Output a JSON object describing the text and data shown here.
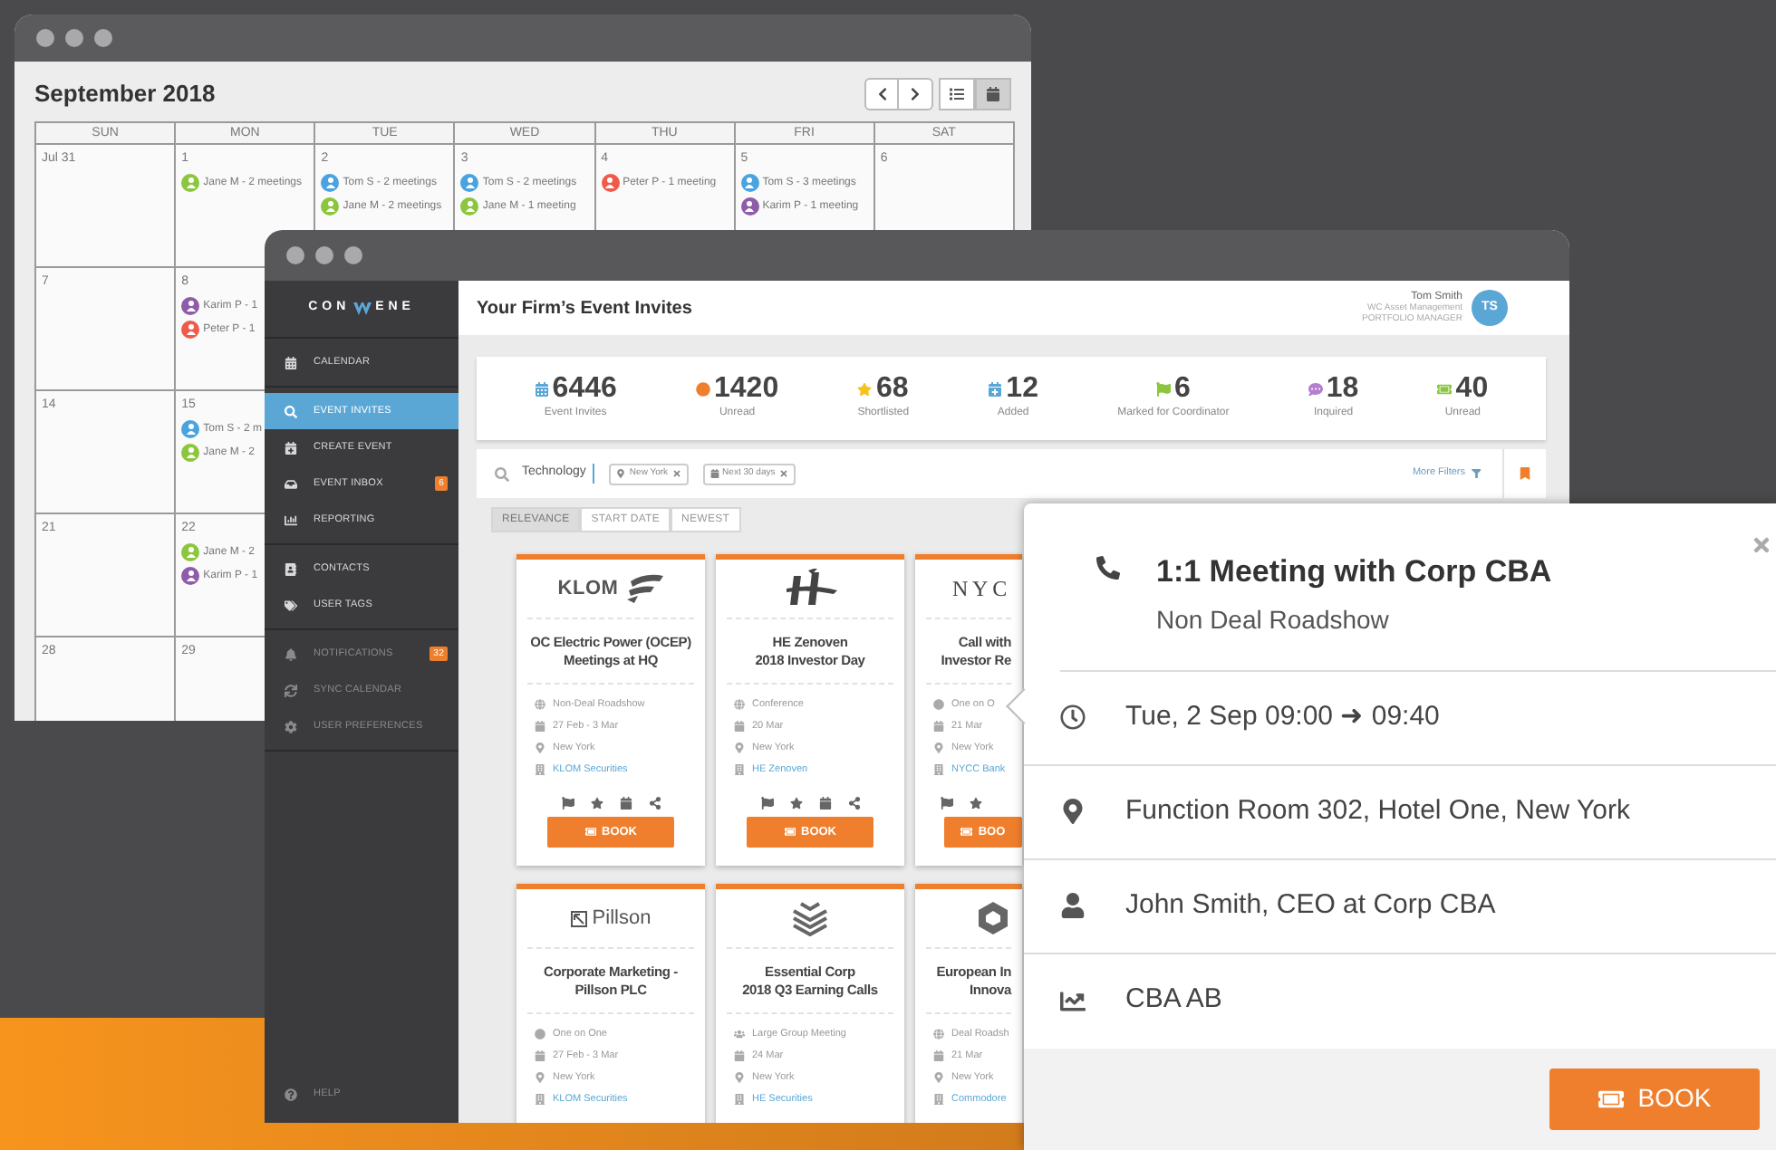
{
  "calendar_window": {
    "title": "September 2018",
    "views": [
      {
        "selected": false
      },
      {
        "selected": true
      }
    ],
    "weekdays": [
      "SUN",
      "MON",
      "TUE",
      "WED",
      "THU",
      "FRI",
      "SAT"
    ],
    "weeks": [
      {
        "days": [
          {
            "label": "Jul 31"
          },
          {
            "label": "1",
            "entries": [
              {
                "text": "Jane M - 2 meetings",
                "color": "#8cc63f"
              }
            ]
          },
          {
            "label": "2",
            "entries": [
              {
                "text": "Tom S - 2 meetings",
                "color": "#4aa3df"
              },
              {
                "text": "Jane M - 2 meetings",
                "color": "#8cc63f"
              }
            ]
          },
          {
            "label": "3",
            "entries": [
              {
                "text": "Tom S - 2 meetings",
                "color": "#4aa3df"
              },
              {
                "text": "Jane M - 1 meeting",
                "color": "#8cc63f"
              }
            ]
          },
          {
            "label": "4",
            "entries": [
              {
                "text": "Peter P - 1 meeting",
                "color": "#f05a4a"
              }
            ]
          },
          {
            "label": "5",
            "entries": [
              {
                "text": "Tom S - 3 meetings",
                "color": "#4aa3df"
              },
              {
                "text": "Karim P - 1 meeting",
                "color": "#8e5ca8"
              }
            ]
          },
          {
            "label": "6"
          }
        ]
      },
      {
        "days": [
          {
            "label": "7"
          },
          {
            "label": "8",
            "entries": [
              {
                "text": "Karim P - 1",
                "color": "#8e5ca8"
              },
              {
                "text": "Peter P - 1",
                "color": "#f05a4a"
              }
            ]
          }
        ]
      },
      {
        "days": [
          {
            "label": "14"
          },
          {
            "label": "15",
            "entries": [
              {
                "text": "Tom S - 2 m",
                "color": "#4aa3df"
              },
              {
                "text": "Jane M - 2",
                "color": "#8cc63f"
              }
            ]
          }
        ]
      },
      {
        "days": [
          {
            "label": "21"
          },
          {
            "label": "22",
            "entries": [
              {
                "text": "Jane M - 2",
                "color": "#8cc63f"
              },
              {
                "text": "Karim P - 1",
                "color": "#8e5ca8"
              }
            ]
          }
        ]
      },
      {
        "days": [
          {
            "label": "28"
          },
          {
            "label": "29"
          }
        ]
      }
    ]
  },
  "app_window": {
    "logo_left": "CON",
    "logo_right": "ENE",
    "sidebar": {
      "sections": [
        {
          "muted": false,
          "items": [
            {
              "label": "CALENDAR",
              "selected": false
            }
          ]
        },
        {
          "muted": false,
          "items": [
            {
              "label": "EVENT INVITES",
              "selected": true
            },
            {
              "label": "CREATE EVENT",
              "selected": false
            },
            {
              "label": "EVENT INBOX",
              "selected": false,
              "badge": "6"
            },
            {
              "label": "REPORTING",
              "selected": false
            }
          ]
        },
        {
          "muted": false,
          "items": [
            {
              "label": "CONTACTS",
              "selected": false
            },
            {
              "label": "USER TAGS",
              "selected": false
            }
          ]
        },
        {
          "muted": true,
          "items": [
            {
              "label": "NOTIFICATIONS",
              "selected": false,
              "badge": "32"
            },
            {
              "label": "SYNC CALENDAR",
              "selected": false
            },
            {
              "label": "USER PREFERENCES",
              "selected": false
            }
          ]
        }
      ],
      "help": "HELP"
    },
    "header": {
      "title": "Your Firm’s Event Invites",
      "user_name": "Tom Smith",
      "company": "WC Asset Management",
      "role": "PORTFOLIO MANAGER",
      "initials": "TS"
    },
    "stats": [
      {
        "value": "6446",
        "label": "Event Invites",
        "color": "#5aa7d6"
      },
      {
        "value": "1420",
        "label": "Unread",
        "color": "#f07f2d"
      },
      {
        "value": "68",
        "label": "Shortlisted",
        "color": "#f5c31c"
      },
      {
        "value": "12",
        "label": "Added",
        "color": "#5aa7d6"
      },
      {
        "value": "6",
        "label": "Marked for Coordinator",
        "color": "#8cc63f"
      },
      {
        "value": "18",
        "label": "Inquired",
        "color": "#b57fcf"
      },
      {
        "value": "40",
        "label": "Unread",
        "color": "#8cc63f"
      }
    ],
    "search": {
      "value": "Technology",
      "chips": [
        "New York",
        "Next 30 days"
      ],
      "more_filters": "More Filters"
    },
    "sort_tabs": [
      {
        "label": "RELEVANCE",
        "selected": true
      },
      {
        "label": "START DATE",
        "selected": false
      },
      {
        "label": "NEWEST",
        "selected": false
      }
    ],
    "cards": [
      {
        "logo": {
          "kind": "swoosh-wordmark",
          "text": "KLOM"
        },
        "title": [
          "OC Electric Power (OCEP)",
          "Meetings at HQ"
        ],
        "type": {
          "text": "Non-Deal Roadshow",
          "kind": "public"
        },
        "date": "27 Feb - 3 Mar",
        "location": "New York",
        "company": "KLOM Securities",
        "book": "BOOK"
      },
      {
        "logo": {
          "kind": "bird-mark"
        },
        "title": [
          "HE Zenoven",
          "2018 Investor Day"
        ],
        "type": {
          "text": "Conference",
          "kind": "public"
        },
        "date": "20 Mar",
        "location": "New York",
        "company": "HE Zenoven",
        "book": "BOOK"
      },
      {
        "logo": {
          "kind": "serif-wordmark",
          "text": "NYC"
        },
        "title": [
          "Call with",
          "Investor Re"
        ],
        "type": {
          "text": "One on O",
          "kind": "private"
        },
        "date": "21 Mar",
        "location": "New York",
        "company": "NYCC Bank",
        "book": "BOO"
      },
      {
        "logo": {
          "kind": "boxed-wordmark",
          "text": "Pillson"
        },
        "title": [
          "Corporate Marketing -",
          "Pillson PLC"
        ],
        "type": {
          "text": "One on One",
          "kind": "private"
        },
        "date": "27 Feb - 3 Mar",
        "location": "New York",
        "company": "KLOM Securities"
      },
      {
        "logo": {
          "kind": "layers-mark"
        },
        "title": [
          "Essential Corp",
          "2018 Q3 Earning Calls"
        ],
        "type": {
          "text": "Large Group Meeting",
          "kind": "group"
        },
        "date": "24 Mar",
        "location": "New York",
        "company": "HE Securities"
      },
      {
        "logo": {
          "kind": "hexagon-mark"
        },
        "title": [
          "European In",
          "Innova"
        ],
        "type": {
          "text": "Deal Roadsh",
          "kind": "public"
        },
        "date": "21 Mar",
        "location": "New York",
        "company": "Commodore"
      }
    ]
  },
  "popup": {
    "title": "1:1 Meeting with Corp CBA",
    "subtitle": "Non Deal Roadshow",
    "time": "Tue, 2 Sep 09:00 ➜ 09:40",
    "place": "Function Room 302, Hotel One, New York",
    "contact": "John Smith, CEO at Corp CBA",
    "company": "CBA AB",
    "book": "BOOK"
  }
}
